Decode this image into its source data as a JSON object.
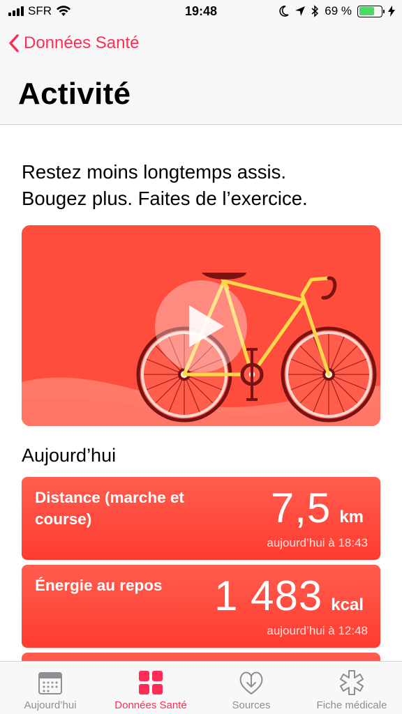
{
  "status_bar": {
    "carrier": "SFR",
    "time": "19:48",
    "battery_percent": "69 %",
    "battery_level": 0.69
  },
  "nav": {
    "back_label": "Données Santé",
    "title": "Activité"
  },
  "intro": {
    "line1": "Restez moins longtemps assis.",
    "line2": "Bougez plus. Faites de l’exercice."
  },
  "section_title": "Aujourd’hui",
  "cards": [
    {
      "label_line1": "Distance (marche et",
      "label_line2": "course)",
      "value": "7,5",
      "unit": "km",
      "time": "aujourd’hui à 18:43"
    },
    {
      "label_line1": "Énergie au repos",
      "label_line2": "",
      "value": "1 483",
      "unit": "kcal",
      "time": "aujourd’hui à 12:48"
    }
  ],
  "tabs": [
    {
      "label": "Aujourd’hui",
      "icon": "calendar-icon",
      "active": false
    },
    {
      "label": "Données Santé",
      "icon": "grid-icon",
      "active": true
    },
    {
      "label": "Sources",
      "icon": "heart-download-icon",
      "active": false
    },
    {
      "label": "Fiche médicale",
      "icon": "asterisk-icon",
      "active": false
    }
  ],
  "colors": {
    "accent": "#ff2d55",
    "card": "#ff3b30",
    "battery": "#4cd964"
  }
}
